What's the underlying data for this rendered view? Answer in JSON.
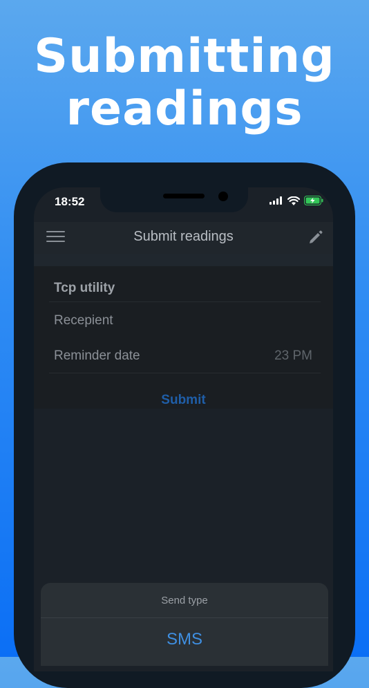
{
  "headline": {
    "line1": "Submitting",
    "line2": "readings"
  },
  "status_bar": {
    "time": "18:52",
    "icons": [
      "cellular-signal-icon",
      "wifi-icon",
      "battery-charging-icon"
    ]
  },
  "navbar": {
    "title": "Submit readings",
    "left_icon": "hamburger-menu-icon",
    "right_icon": "pencil-edit-icon"
  },
  "card": {
    "title": "Tcp utility",
    "recipient_label": "Recepient",
    "reminder_label": "Reminder date",
    "reminder_value": "23 PM",
    "submit_label": "Submit"
  },
  "action_sheet": {
    "title": "Send type",
    "option": "SMS"
  },
  "colors": {
    "accent": "#3f8fe2",
    "background_top": "#5ba8ee",
    "background_bottom": "#0b6ff5",
    "battery_green": "#34c759"
  }
}
